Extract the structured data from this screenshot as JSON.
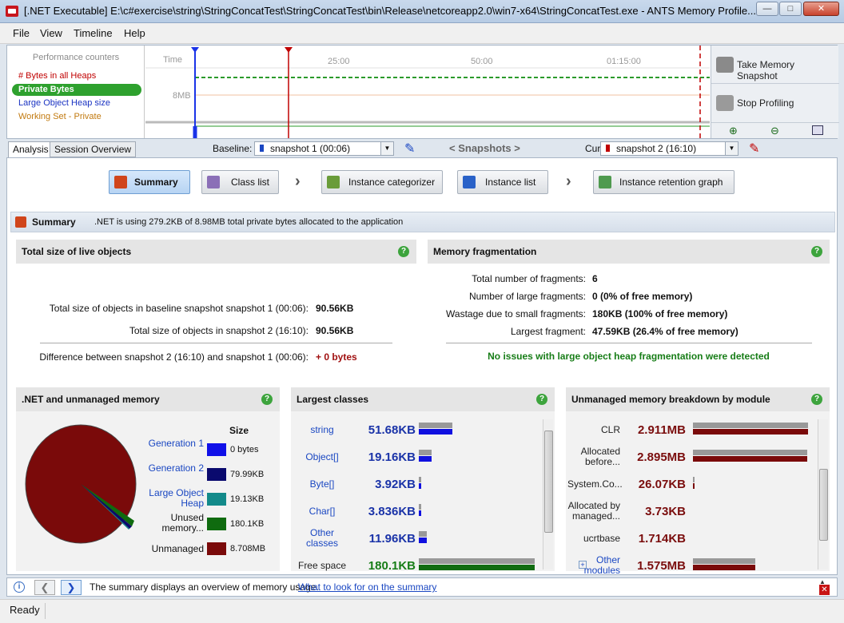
{
  "window": {
    "title": "[.NET Executable] E:\\c#exercise\\string\\StringConcatTest\\StringConcatTest\\bin\\Release\\netcoreapp2.0\\win7-x64\\StringConcatTest.exe - ANTS Memory Profile..."
  },
  "menu": [
    "File",
    "View",
    "Timeline",
    "Help"
  ],
  "counters": {
    "header": "Performance counters",
    "items": [
      {
        "label": "# Bytes in all Heaps",
        "color": "#c00000"
      },
      {
        "label": "Private Bytes",
        "color": "#ffffff"
      },
      {
        "label": "Large Object Heap size",
        "color": "#1a33c2"
      },
      {
        "label": "Working Set - Private",
        "color": "#c27a10"
      }
    ]
  },
  "timeline": {
    "time_label": "Time",
    "mem_label": "8MB",
    "ticks": [
      "25:00",
      "50:00",
      "01:15:00"
    ]
  },
  "side_buttons": {
    "take_snapshot": "Take Memory Snapshot",
    "stop_profiling": "Stop Profiling"
  },
  "tabs": {
    "analysis": "Analysis",
    "session": "Session Overview"
  },
  "baseline": {
    "label": "Baseline:",
    "value": "snapshot 1 (00:06)"
  },
  "snapshots_title": "< Snapshots >",
  "current": {
    "label": "Current:",
    "value": "snapshot 2 (16:10)"
  },
  "nav": {
    "summary": "Summary",
    "class_list": "Class list",
    "instance_categorizer": "Instance categorizer",
    "instance_list": "Instance list",
    "retention_graph": "Instance retention graph"
  },
  "summary_bar": {
    "title": "Summary",
    "text": ".NET is using 279.2KB of 8.98MB total private bytes allocated to the application"
  },
  "live_objects": {
    "title": "Total size of live objects",
    "rows": [
      {
        "label": "Total size of objects in baseline snapshot snapshot 1 (00:06):",
        "value": "90.56KB"
      },
      {
        "label": "Total size of objects in snapshot 2 (16:10):",
        "value": "90.56KB"
      }
    ],
    "diff_label": "Difference between snapshot 2 (16:10) and snapshot 1 (00:06):",
    "diff_value": "+ 0 bytes"
  },
  "fragmentation": {
    "title": "Memory fragmentation",
    "rows": [
      {
        "label": "Total number of fragments:",
        "value": "6"
      },
      {
        "label": "Number of large fragments:",
        "value": "0 (0% of free memory)"
      },
      {
        "label": "Wastage due to small fragments:",
        "value": "180KB (100% of free memory)"
      },
      {
        "label": "Largest fragment:",
        "value": "47.59KB (26.4% of free memory)"
      }
    ],
    "status": "No issues with large object heap fragmentation were detected"
  },
  "net_memory": {
    "title": ".NET and unmanaged memory",
    "size_header": "Size",
    "legend": [
      {
        "name": "Generation 1",
        "size": "0 bytes",
        "color": "#1010e8"
      },
      {
        "name": "Generation 2",
        "size": "79.99KB",
        "color": "#0a0a6e"
      },
      {
        "name": "Large Object Heap",
        "size": "19.13KB",
        "color": "#138a8a"
      },
      {
        "name": "Unused memory...",
        "size": "180.1KB",
        "color": "#0f6b0f"
      },
      {
        "name": "Unmanaged",
        "size": "8.708MB",
        "color": "#7a0a0a"
      }
    ]
  },
  "largest_classes": {
    "title": "Largest classes",
    "items": [
      {
        "name": "string",
        "value": "51.68KB",
        "a": 1.0,
        "b": 1.0
      },
      {
        "name": "Object[]",
        "value": "19.16KB",
        "a": 0.37,
        "b": 0.37
      },
      {
        "name": "Byte[]",
        "value": "3.92KB",
        "a": 0.08,
        "b": 0.08
      },
      {
        "name": "Char[]",
        "value": "3.836KB",
        "a": 0.07,
        "b": 0.07
      },
      {
        "name": "Other classes",
        "value": "11.96KB",
        "a": 0.23,
        "b": 0.23
      },
      {
        "name": "Free space",
        "value": "180.1KB",
        "a": 1.0,
        "b": 1.0
      }
    ]
  },
  "unmanaged": {
    "title": "Unmanaged memory breakdown by module",
    "items": [
      {
        "name": "CLR",
        "value": "2.911MB",
        "a": 1.0
      },
      {
        "name": "Allocated before...",
        "value": "2.895MB",
        "a": 0.99
      },
      {
        "name": "System.Co...",
        "value": "26.07KB",
        "a": 0.01
      },
      {
        "name": "Allocated by managed...",
        "value": "3.73KB",
        "a": 0.0
      },
      {
        "name": "ucrtbase",
        "value": "1.714KB",
        "a": 0.0
      },
      {
        "name": "Other modules",
        "value": "1.575MB",
        "a": 0.54
      }
    ]
  },
  "tip": {
    "text": "The summary displays an overview of memory usage.",
    "link": "What to look for on the summary"
  },
  "status": "Ready"
}
